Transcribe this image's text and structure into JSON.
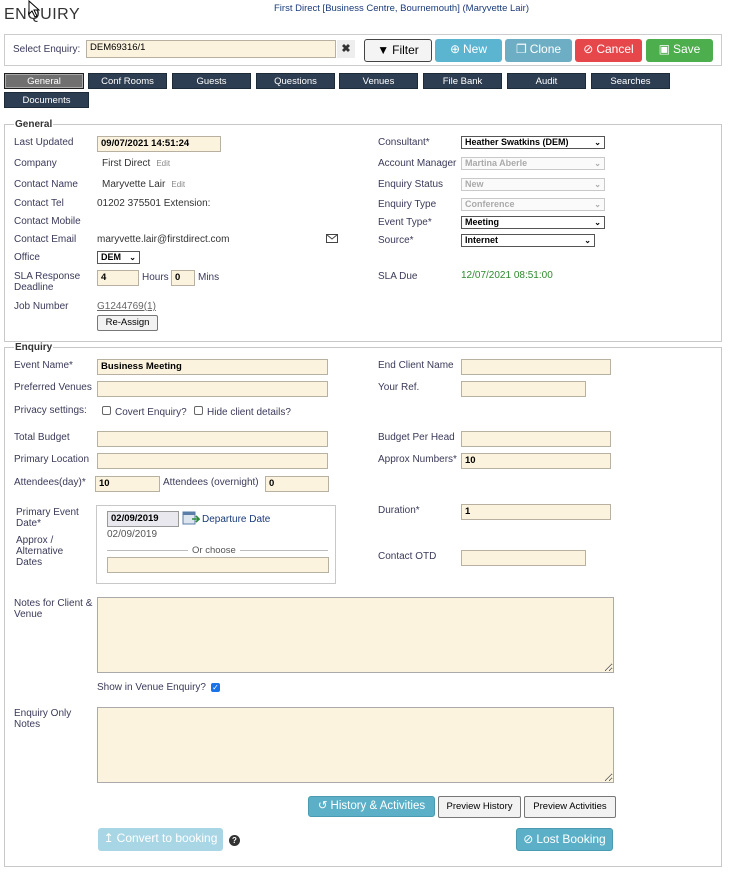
{
  "header": {
    "title": "ENQUIRY",
    "context": "First Direct [Business Centre, Bournemouth] (Maryvette Lair)"
  },
  "toolbar": {
    "select_label": "Select Enquiry:",
    "enquiry_value": "DEM69316/1",
    "filter_label": "Filter",
    "new_label": "New",
    "clone_label": "Clone",
    "cancel_label": "Cancel",
    "save_label": "Save"
  },
  "tabs": [
    "General",
    "Conf Rooms",
    "Guests",
    "Questions",
    "Venues",
    "File Bank",
    "Audit",
    "Searches",
    "Documents"
  ],
  "general": {
    "legend": "General",
    "last_updated_label": "Last Updated",
    "last_updated": "09/07/2021 14:51:24",
    "company_label": "Company",
    "company": "First Direct",
    "edit_label": "Edit",
    "contact_name_label": "Contact Name",
    "contact_name": "Maryvette Lair",
    "contact_tel_label": "Contact Tel",
    "contact_tel": "01202 375501 Extension:",
    "contact_mobile_label": "Contact Mobile",
    "contact_email_label": "Contact Email",
    "contact_email": "maryvette.lair@firstdirect.com",
    "office_label": "Office",
    "office": "DEM",
    "sla_label": "SLA Response Deadline",
    "sla_hours": "4",
    "hours_label": "Hours",
    "sla_mins": "0",
    "mins_label": "Mins",
    "job_label": "Job Number",
    "job_number": "G1244769(1)",
    "reassign_label": "Re-Assign",
    "consultant_label": "Consultant*",
    "consultant": "Heather Swatkins (DEM)",
    "account_manager_label": "Account Manager",
    "account_manager": "Martina Aberle",
    "status_label": "Enquiry Status",
    "status": "New",
    "type_label": "Enquiry Type",
    "type": "Conference",
    "event_type_label": "Event Type*",
    "event_type": "Meeting",
    "source_label": "Source*",
    "source": "Internet",
    "sla_due_label": "SLA Due",
    "sla_due": "12/07/2021 08:51:00"
  },
  "enquiry": {
    "legend": "Enquiry",
    "event_name_label": "Event Name*",
    "event_name": "Business Meeting",
    "end_client_label": "End Client Name",
    "preferred_venues_label": "Preferred Venues",
    "your_ref_label": "Your Ref.",
    "privacy_label": "Privacy settings:",
    "covert_label": "Covert Enquiry?",
    "hide_label": "Hide client details?",
    "total_budget_label": "Total Budget",
    "budget_head_label": "Budget Per Head",
    "primary_location_label": "Primary Location",
    "approx_numbers_label": "Approx Numbers*",
    "approx_numbers": "10",
    "attendees_day_label": "Attendees(day)*",
    "attendees_day": "10",
    "attendees_night_label": "Attendees (overnight)",
    "attendees_night": "0",
    "primary_date_label": "Primary Event Date*",
    "primary_date": "02/09/2019",
    "departure_label": "Departure Date",
    "departure_date": "02/09/2019",
    "alt_dates_label": "Approx / Alternative Dates",
    "or_choose": "Or choose",
    "duration_label": "Duration*",
    "duration": "1",
    "contact_otd_label": "Contact OTD",
    "notes_label": "Notes for Client & Venue",
    "show_in_venue_label": "Show in Venue Enquiry?",
    "enquiry_notes_label": "Enquiry Only Notes",
    "history_label": "History & Activities",
    "preview_history_label": "Preview History",
    "preview_activities_label": "Preview Activities",
    "convert_label": "Convert to booking",
    "lost_label": "Lost Booking"
  },
  "colors": {
    "tab_bg": "#2e3e52",
    "input_bg": "#fbf3dd",
    "new_btn": "#5bc0de",
    "cancel_btn": "#e84c4c",
    "save_btn": "#4cae4c",
    "sla_due": "#2e8b2e"
  }
}
